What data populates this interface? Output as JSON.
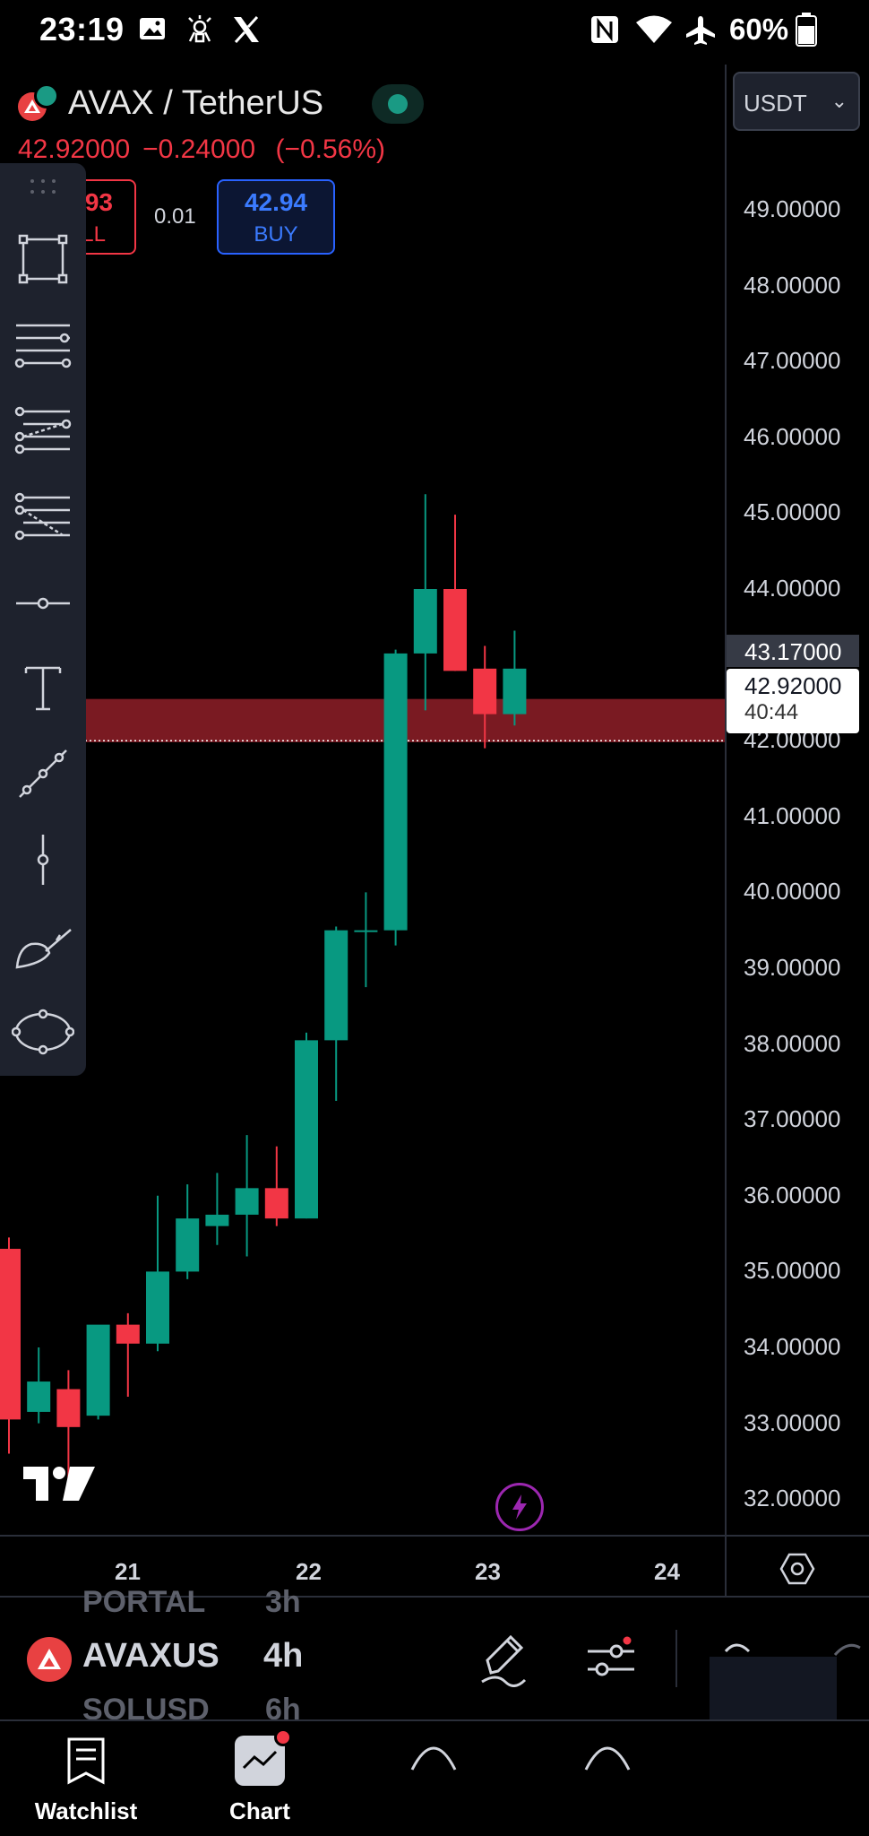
{
  "status_bar": {
    "time": "23:19",
    "battery": "60%",
    "icons": [
      "gallery-icon",
      "app-notification-icon",
      "x-logo-icon",
      "nfc-icon",
      "wifi-icon",
      "airplane-mode-icon",
      "battery-icon"
    ]
  },
  "header": {
    "symbol": "AVAX / TetherUS",
    "price": "42.92000",
    "change": "−0.24000",
    "change_pct": "(−0.56%)",
    "currency": "USDT"
  },
  "trade": {
    "sell_price": "93",
    "sell_label": "LL",
    "spread": "0.01",
    "buy_price": "42.94",
    "buy_label": "BUY"
  },
  "toolbar": {
    "tools": [
      "rectangle-tool-icon",
      "horizontal-lines-icon",
      "parallel-channel-icon",
      "fib-channel-icon",
      "horizontal-ray-icon",
      "text-tool-icon",
      "trend-line-icon",
      "vertical-line-icon",
      "brush-tool-icon",
      "ellipse-tool-icon"
    ]
  },
  "price_axis": {
    "labels": [
      "49.00000",
      "48.00000",
      "47.00000",
      "46.00000",
      "45.00000",
      "44.00000",
      "42.00000",
      "41.00000",
      "40.00000",
      "39.00000",
      "38.00000",
      "37.00000",
      "36.00000",
      "35.00000",
      "34.00000",
      "33.00000",
      "32.00000"
    ],
    "last_price": "43.17000",
    "current_price": "42.92000",
    "countdown": "40:44"
  },
  "time_axis": {
    "labels": [
      "21",
      "22",
      "23",
      "24"
    ]
  },
  "chart_data": {
    "type": "candlestick",
    "title": "",
    "y_unit": "USDT",
    "timeframe": "4h",
    "candles": [
      {
        "o": 35.3,
        "h": 35.45,
        "l": 32.6,
        "c": 33.05
      },
      {
        "o": 33.15,
        "h": 34.0,
        "l": 33.0,
        "c": 33.55
      },
      {
        "o": 33.45,
        "h": 33.7,
        "l": 32.15,
        "c": 32.95
      },
      {
        "o": 33.1,
        "h": 34.25,
        "l": 33.05,
        "c": 34.3
      },
      {
        "o": 34.3,
        "h": 34.45,
        "l": 33.35,
        "c": 34.05
      },
      {
        "o": 34.05,
        "h": 36.0,
        "l": 33.95,
        "c": 35.0
      },
      {
        "o": 35.0,
        "h": 36.15,
        "l": 34.9,
        "c": 35.7
      },
      {
        "o": 35.6,
        "h": 36.3,
        "l": 35.35,
        "c": 35.75
      },
      {
        "o": 35.75,
        "h": 36.8,
        "l": 35.2,
        "c": 36.1
      },
      {
        "o": 36.1,
        "h": 36.65,
        "l": 35.6,
        "c": 35.7
      },
      {
        "o": 35.7,
        "h": 38.15,
        "l": 35.7,
        "c": 38.05
      },
      {
        "o": 38.05,
        "h": 39.55,
        "l": 37.25,
        "c": 39.5
      },
      {
        "o": 39.5,
        "h": 40.0,
        "l": 38.75,
        "c": 39.5
      },
      {
        "o": 39.5,
        "h": 43.2,
        "l": 39.3,
        "c": 43.15
      },
      {
        "o": 43.15,
        "h": 45.25,
        "l": 42.4,
        "c": 44.0
      },
      {
        "o": 44.0,
        "h": 44.98,
        "l": 42.92,
        "c": 42.92
      },
      {
        "o": 42.95,
        "h": 43.25,
        "l": 41.9,
        "c": 42.35
      },
      {
        "o": 42.35,
        "h": 43.45,
        "l": 42.2,
        "c": 42.95
      }
    ],
    "zone": {
      "from": 41.98,
      "to": 42.55
    },
    "up_color": "#089981",
    "down_color": "#f23645",
    "zone_color": "#7a1a22",
    "ylim": [
      31.5,
      50.0
    ]
  },
  "symbol_bar": {
    "ghost_top": "PORTAL",
    "ghost_top_tf": "3h",
    "symbol": "AVAXUS",
    "timeframe": "4h",
    "ghost_bottom": "SOLUSD",
    "ghost_bottom_tf": "6h"
  },
  "bottom_nav": {
    "items": [
      {
        "label": "Watchlist",
        "icon": "watchlist-icon"
      },
      {
        "label": "Chart",
        "icon": "chart-icon"
      },
      {
        "label": "",
        "icon": "explore-icon"
      },
      {
        "label": "",
        "icon": "ideas-icon"
      }
    ]
  }
}
